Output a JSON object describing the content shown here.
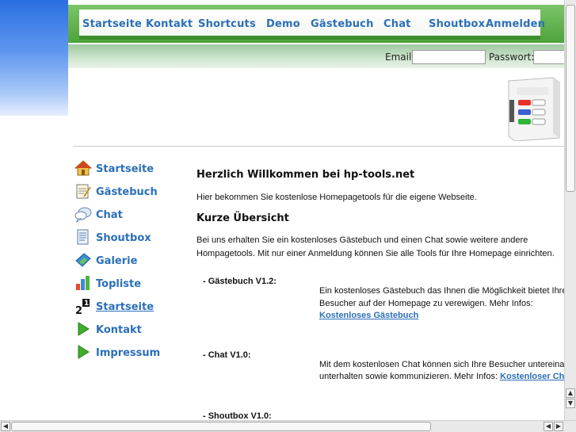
{
  "nav": {
    "items": [
      "Startseite",
      "Kontakt",
      "Shortcuts",
      "Demo",
      "Gästebuch",
      "Chat",
      "Shoutbox",
      "Anmelden"
    ]
  },
  "login": {
    "email_label": "Email:",
    "password_label": "Passwort:",
    "email_value": "",
    "password_value": ""
  },
  "sidebar": {
    "items": [
      {
        "label": "Startseite",
        "icon": "home-icon"
      },
      {
        "label": "Gästebuch",
        "icon": "notepad-icon"
      },
      {
        "label": "Chat",
        "icon": "chat-icon"
      },
      {
        "label": "Shoutbox",
        "icon": "document-icon"
      },
      {
        "label": "Galerie",
        "icon": "gallery-icon"
      },
      {
        "label": "Topliste",
        "icon": "bar-chart-icon"
      },
      {
        "label": "Startseite",
        "icon": "ranking-icon"
      },
      {
        "label": "Kontakt",
        "icon": "green-arrow-icon"
      },
      {
        "label": "Impressum",
        "icon": "green-arrow-icon"
      }
    ]
  },
  "content": {
    "welcome_title": "Herzlich Willkommen bei hp-tools.net",
    "welcome_text": "Hier bekommen Sie kostenlose Homepagetools für die eigene Webseite.",
    "overview_title": "Kurze Übersicht",
    "overview_line1": "Bei uns erhalten Sie ein kostenloses Gästebuch und einen Chat sowie weitere andere",
    "overview_line2": "Hompagetools. Mit nur einer Anmeldung können Sie alle Tools für Ihre Homepage einrichten.",
    "tools": [
      {
        "name": "- Gästebuch V1.2:",
        "line1": "Ein kostenloses Gästebuch das Ihnen die Möglichkeit bietet Ihre",
        "line2": "Besucher auf der Homepage zu verewigen. Mehr Infos:",
        "link": "Kostenloses Gästebuch"
      },
      {
        "name": "- Chat V1.0:",
        "line1": "Mit dem kostenlosen Chat können sich Ihre Besucher untereinander",
        "line2": "unterhalten sowie kommunizieren. Mehr Infos:",
        "link": "Kostenloser Chat"
      },
      {
        "name": "- Shoutbox V1.0:"
      }
    ]
  },
  "colors": {
    "link": "#2b6fb8",
    "nav_green": "#4ea33c"
  }
}
